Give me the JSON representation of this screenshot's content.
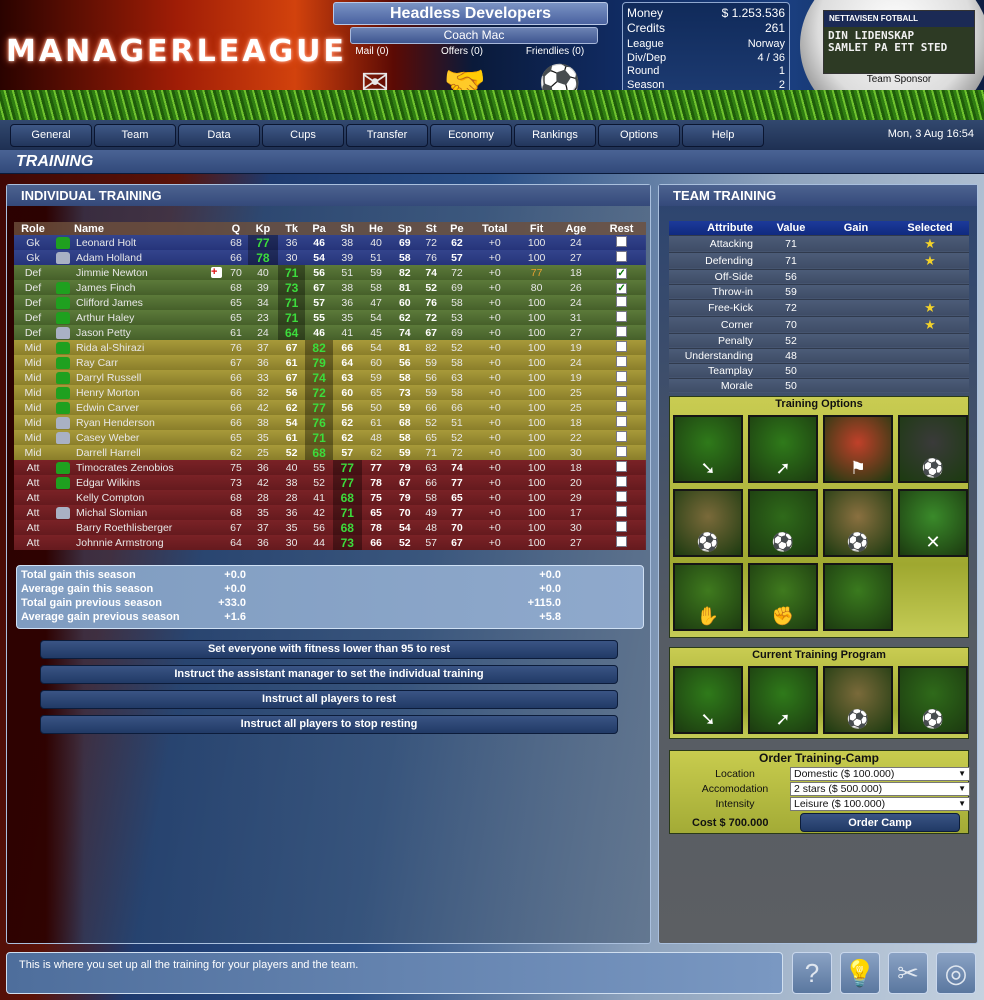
{
  "header": {
    "logo": "MANAGERLEAGUE",
    "team_name": "Headless Developers",
    "coach": "Coach Mac",
    "quick_links": [
      {
        "label": "Mail (0)",
        "icon": "mail-figure-icon"
      },
      {
        "label": "Offers (0)",
        "icon": "handshake-figure-icon"
      },
      {
        "label": "Friendlies (0)",
        "icon": "kick-figure-icon"
      }
    ],
    "stats": {
      "money_label": "Money",
      "money": "$ 1.253.536",
      "credits_label": "Credits",
      "credits": "261",
      "league_label": "League",
      "league": "Norway",
      "divdep_label": "Div/Dep",
      "divdep": "4 / 36",
      "round_label": "Round",
      "round": "1",
      "season_label": "Season",
      "season": "2"
    },
    "sponsor": {
      "brand": "NETTAVISEN  FOTBALL",
      "slogan_1": "DIN LIDENSKAP",
      "slogan_2": "SAMLET PA ETT STED",
      "label": "Team Sponsor"
    }
  },
  "nav": {
    "items": [
      "General",
      "Team",
      "Data",
      "Cups",
      "Transfer",
      "Economy",
      "Rankings",
      "Options",
      "Help"
    ],
    "datetime": "Mon, 3 Aug 16:54"
  },
  "page": {
    "title": "TRAINING"
  },
  "individual": {
    "title": "INDIVIDUAL TRAINING",
    "columns": [
      "Role",
      "Name",
      "Q",
      "Kp",
      "Tk",
      "Pa",
      "Sh",
      "He",
      "Sp",
      "St",
      "Pe",
      "Total",
      "Fit",
      "Age",
      "Rest"
    ],
    "players": [
      {
        "role": "Gk",
        "shirt": "green",
        "name": "Leonard Holt",
        "injured": false,
        "q": 68,
        "kp": 77,
        "tk": 36,
        "pa": 46,
        "sh": 38,
        "he": 40,
        "sp": 69,
        "st": 72,
        "pe": 62,
        "total": "+0",
        "fit": 100,
        "age": 24,
        "rest": false
      },
      {
        "role": "Gk",
        "shirt": "grey",
        "name": "Adam Holland",
        "injured": false,
        "q": 66,
        "kp": 78,
        "tk": 30,
        "pa": 54,
        "sh": 39,
        "he": 51,
        "sp": 58,
        "st": 76,
        "pe": 57,
        "total": "+0",
        "fit": 100,
        "age": 27,
        "rest": false
      },
      {
        "role": "Def",
        "shirt": "none",
        "name": "Jimmie Newton",
        "injured": true,
        "q": 70,
        "kp": 40,
        "tk": 71,
        "pa": 56,
        "sh": 51,
        "he": 59,
        "sp": 82,
        "st": 74,
        "pe": 72,
        "total": "+0",
        "fit": 77,
        "age": 18,
        "rest": true
      },
      {
        "role": "Def",
        "shirt": "green",
        "name": "James Finch",
        "injured": false,
        "q": 68,
        "kp": 39,
        "tk": 73,
        "pa": 67,
        "sh": 38,
        "he": 58,
        "sp": 81,
        "st": 52,
        "pe": 69,
        "total": "+0",
        "fit": 80,
        "age": 26,
        "rest": true
      },
      {
        "role": "Def",
        "shirt": "green",
        "name": "Clifford James",
        "injured": false,
        "q": 65,
        "kp": 34,
        "tk": 71,
        "pa": 57,
        "sh": 36,
        "he": 47,
        "sp": 60,
        "st": 76,
        "pe": 58,
        "total": "+0",
        "fit": 100,
        "age": 24,
        "rest": false
      },
      {
        "role": "Def",
        "shirt": "green",
        "name": "Arthur Haley",
        "injured": false,
        "q": 65,
        "kp": 23,
        "tk": 71,
        "pa": 55,
        "sh": 35,
        "he": 54,
        "sp": 62,
        "st": 72,
        "pe": 53,
        "total": "+0",
        "fit": 100,
        "age": 31,
        "rest": false
      },
      {
        "role": "Def",
        "shirt": "grey",
        "name": "Jason Petty",
        "injured": false,
        "q": 61,
        "kp": 24,
        "tk": 64,
        "pa": 46,
        "sh": 41,
        "he": 45,
        "sp": 74,
        "st": 67,
        "pe": 69,
        "total": "+0",
        "fit": 100,
        "age": 27,
        "rest": false
      },
      {
        "role": "Mid",
        "shirt": "green",
        "name": "Rida al-Shirazi",
        "injured": false,
        "q": 76,
        "kp": 37,
        "tk": 67,
        "pa": 82,
        "sh": 66,
        "he": 54,
        "sp": 81,
        "st": 82,
        "pe": 52,
        "total": "+0",
        "fit": 100,
        "age": 19,
        "rest": false
      },
      {
        "role": "Mid",
        "shirt": "green",
        "name": "Ray Carr",
        "injured": false,
        "q": 67,
        "kp": 36,
        "tk": 61,
        "pa": 79,
        "sh": 64,
        "he": 60,
        "sp": 56,
        "st": 59,
        "pe": 58,
        "total": "+0",
        "fit": 100,
        "age": 24,
        "rest": false
      },
      {
        "role": "Mid",
        "shirt": "green",
        "name": "Darryl Russell",
        "injured": false,
        "q": 66,
        "kp": 33,
        "tk": 67,
        "pa": 74,
        "sh": 63,
        "he": 59,
        "sp": 58,
        "st": 56,
        "pe": 63,
        "total": "+0",
        "fit": 100,
        "age": 19,
        "rest": false
      },
      {
        "role": "Mid",
        "shirt": "green",
        "name": "Henry Morton",
        "injured": false,
        "q": 66,
        "kp": 32,
        "tk": 56,
        "pa": 72,
        "sh": 60,
        "he": 65,
        "sp": 73,
        "st": 59,
        "pe": 58,
        "total": "+0",
        "fit": 100,
        "age": 25,
        "rest": false
      },
      {
        "role": "Mid",
        "shirt": "green",
        "name": "Edwin Carver",
        "injured": false,
        "q": 66,
        "kp": 42,
        "tk": 62,
        "pa": 77,
        "sh": 56,
        "he": 50,
        "sp": 59,
        "st": 66,
        "pe": 66,
        "total": "+0",
        "fit": 100,
        "age": 25,
        "rest": false
      },
      {
        "role": "Mid",
        "shirt": "grey",
        "name": "Ryan Henderson",
        "injured": false,
        "q": 66,
        "kp": 38,
        "tk": 54,
        "pa": 76,
        "sh": 62,
        "he": 61,
        "sp": 68,
        "st": 52,
        "pe": 51,
        "total": "+0",
        "fit": 100,
        "age": 18,
        "rest": false
      },
      {
        "role": "Mid",
        "shirt": "grey",
        "name": "Casey Weber",
        "injured": false,
        "q": 65,
        "kp": 35,
        "tk": 61,
        "pa": 71,
        "sh": 62,
        "he": 48,
        "sp": 58,
        "st": 65,
        "pe": 52,
        "total": "+0",
        "fit": 100,
        "age": 22,
        "rest": false
      },
      {
        "role": "Mid",
        "shirt": "none",
        "name": "Darrell Harrell",
        "injured": false,
        "q": 62,
        "kp": 25,
        "tk": 52,
        "pa": 68,
        "sh": 57,
        "he": 62,
        "sp": 59,
        "st": 71,
        "pe": 72,
        "total": "+0",
        "fit": 100,
        "age": 30,
        "rest": false
      },
      {
        "role": "Att",
        "shirt": "green",
        "name": "Timocrates Zenobios",
        "injured": false,
        "q": 75,
        "kp": 36,
        "tk": 40,
        "pa": 55,
        "sh": 77,
        "he": 77,
        "sp": 79,
        "st": 63,
        "pe": 74,
        "total": "+0",
        "fit": 100,
        "age": 18,
        "rest": false
      },
      {
        "role": "Att",
        "shirt": "green",
        "name": "Edgar Wilkins",
        "injured": false,
        "q": 73,
        "kp": 42,
        "tk": 38,
        "pa": 52,
        "sh": 77,
        "he": 78,
        "sp": 67,
        "st": 66,
        "pe": 77,
        "total": "+0",
        "fit": 100,
        "age": 20,
        "rest": false
      },
      {
        "role": "Att",
        "shirt": "none",
        "name": "Kelly Compton",
        "injured": false,
        "q": 68,
        "kp": 28,
        "tk": 28,
        "pa": 41,
        "sh": 68,
        "he": 75,
        "sp": 79,
        "st": 58,
        "pe": 65,
        "total": "+0",
        "fit": 100,
        "age": 29,
        "rest": false
      },
      {
        "role": "Att",
        "shirt": "grey",
        "name": "Michal Slomian",
        "injured": false,
        "q": 68,
        "kp": 35,
        "tk": 36,
        "pa": 42,
        "sh": 71,
        "he": 65,
        "sp": 70,
        "st": 49,
        "pe": 77,
        "total": "+0",
        "fit": 100,
        "age": 17,
        "rest": false
      },
      {
        "role": "Att",
        "shirt": "none",
        "name": "Barry Roethlisberger",
        "injured": false,
        "q": 67,
        "kp": 37,
        "tk": 35,
        "pa": 56,
        "sh": 68,
        "he": 78,
        "sp": 54,
        "st": 48,
        "pe": 70,
        "total": "+0",
        "fit": 100,
        "age": 30,
        "rest": false
      },
      {
        "role": "Att",
        "shirt": "none",
        "name": "Johnnie Armstrong",
        "injured": false,
        "q": 64,
        "kp": 36,
        "tk": 30,
        "pa": 44,
        "sh": 73,
        "he": 66,
        "sp": 52,
        "st": 57,
        "pe": 67,
        "total": "+0",
        "fit": 100,
        "age": 27,
        "rest": false
      }
    ],
    "summary": [
      {
        "label": "Total gain this season",
        "v1": "+0.0",
        "v2": "+0.0"
      },
      {
        "label": "Average gain this season",
        "v1": "+0.0",
        "v2": "+0.0"
      },
      {
        "label": "Total gain previous season",
        "v1": "+33.0",
        "v2": "+115.0"
      },
      {
        "label": "Average gain previous season",
        "v1": "+1.6",
        "v2": "+5.8"
      }
    ],
    "actions": [
      "Set everyone with fitness lower than 95 to rest",
      "Instruct the assistant manager to set the individual training",
      "Instruct all players to rest",
      "Instruct all players to stop resting"
    ]
  },
  "team": {
    "title": "TEAM TRAINING",
    "columns": [
      "Attribute",
      "Value",
      "Gain",
      "Selected"
    ],
    "attributes": [
      {
        "name": "Attacking",
        "value": 71,
        "gain": "",
        "selected": true
      },
      {
        "name": "Defending",
        "value": 71,
        "gain": "",
        "selected": true
      },
      {
        "name": "Off-Side",
        "value": 56,
        "gain": "",
        "selected": false
      },
      {
        "name": "Throw-in",
        "value": 59,
        "gain": "",
        "selected": false
      },
      {
        "name": "Free-Kick",
        "value": 72,
        "gain": "",
        "selected": true
      },
      {
        "name": "Corner",
        "value": 70,
        "gain": "",
        "selected": true
      },
      {
        "name": "Penalty",
        "value": 52,
        "gain": "",
        "selected": false
      },
      {
        "name": "Understanding",
        "value": 48,
        "gain": "",
        "selected": false
      },
      {
        "name": "Teamplay",
        "value": 50,
        "gain": "",
        "selected": false
      },
      {
        "name": "Morale",
        "value": 50,
        "gain": "",
        "selected": false
      }
    ],
    "options_title": "Training Options",
    "options": [
      {
        "name": "attacking",
        "icon": "attack-arrow-icon",
        "color": "#2f7a1a",
        "glyph": "➘"
      },
      {
        "name": "defending",
        "icon": "defend-arrow-icon",
        "color": "#2f7a1a",
        "glyph": "➚"
      },
      {
        "name": "off-side",
        "icon": "flag-icon",
        "color": "#c0402a",
        "glyph": "⚑"
      },
      {
        "name": "throw-in",
        "icon": "throw-in-icon",
        "color": "#3a3a3a",
        "glyph": "⚽"
      },
      {
        "name": "free-kick",
        "icon": "free-kick-icon",
        "color": "#7a6a3a",
        "glyph": "⚽"
      },
      {
        "name": "corner",
        "icon": "corner-icon",
        "color": "#2f6a1a",
        "glyph": "⚽"
      },
      {
        "name": "penalty",
        "icon": "penalty-icon",
        "color": "#8a7040",
        "glyph": "⚽"
      },
      {
        "name": "understanding",
        "icon": "tactics-board-icon",
        "color": "#3a8a2a",
        "glyph": "✕"
      },
      {
        "name": "teamplay",
        "icon": "hands-icon",
        "color": "#3f7a1e",
        "glyph": "✋"
      },
      {
        "name": "morale",
        "icon": "fist-icon",
        "color": "#3f7a1e",
        "glyph": "✊"
      },
      {
        "name": "grass",
        "icon": "grass-icon",
        "color": "#3a7a1e",
        "glyph": ""
      }
    ],
    "program_title": "Current Training Program",
    "program": [
      {
        "name": "attacking",
        "icon": "attack-arrow-icon",
        "color": "#2f7a1a",
        "glyph": "➘"
      },
      {
        "name": "defending",
        "icon": "defend-arrow-icon",
        "color": "#2f7a1a",
        "glyph": "➚"
      },
      {
        "name": "free-kick",
        "icon": "free-kick-icon",
        "color": "#7a6a3a",
        "glyph": "⚽"
      },
      {
        "name": "corner",
        "icon": "corner-icon",
        "color": "#2f6a1a",
        "glyph": "⚽"
      }
    ],
    "camp": {
      "title": "Order Training-Camp",
      "location_label": "Location",
      "location": "Domestic ($ 100.000)",
      "accomodation_label": "Accomodation",
      "accomodation": "2 stars ($ 500.000)",
      "intensity_label": "Intensity",
      "intensity": "Leisure ($ 100.000)",
      "cost": "Cost $ 700.000",
      "order_label": "Order Camp"
    }
  },
  "footer": {
    "message": "This is where you set up all the training for your players and the team.",
    "buttons": [
      {
        "name": "help",
        "glyph": "?"
      },
      {
        "name": "tip",
        "glyph": "💡"
      },
      {
        "name": "tools",
        "glyph": "✂"
      },
      {
        "name": "coins",
        "glyph": "◎"
      }
    ]
  },
  "colors": {
    "highlight_green": "#3cdc3c",
    "gk_row": "#2e3e86",
    "def_row": "#527034",
    "mid_row": "#9a8c32",
    "att_row": "#701e22",
    "star": "#f3d22a",
    "olive_panel": "#b8bc44"
  }
}
